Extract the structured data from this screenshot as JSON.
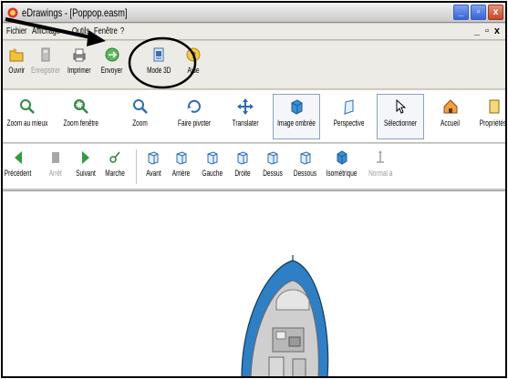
{
  "window": {
    "title": "eDrawings - [Poppop.easm]",
    "controls": {
      "minimize": "_",
      "restore": "▫",
      "close": "x"
    }
  },
  "menubar": {
    "items": [
      "Fichier",
      "Affichage",
      "Outils",
      "Fenêtre",
      "?"
    ],
    "mdi_controls": [
      "_",
      "▫",
      "x"
    ]
  },
  "toolbar_main": {
    "buttons": [
      {
        "label": "Ouvrir",
        "icon": "open-folder-icon",
        "enabled": true
      },
      {
        "label": "Enregistrer",
        "icon": "save-icon",
        "enabled": false
      },
      {
        "label": "Imprimer",
        "icon": "printer-icon",
        "enabled": true
      },
      {
        "label": "Envoyer",
        "icon": "send-icon",
        "enabled": true
      },
      {
        "label": "Mode 3D",
        "icon": "mode-3d-icon",
        "enabled": true
      },
      {
        "label": "Aide",
        "icon": "help-icon",
        "enabled": true
      }
    ]
  },
  "toolbar_view": {
    "buttons": [
      {
        "label": "Zoom au mieux",
        "icon": "zoom-fit-icon"
      },
      {
        "label": "Zoom fenêtre",
        "icon": "zoom-window-icon"
      },
      {
        "label": "Zoom",
        "icon": "zoom-icon"
      },
      {
        "label": "Faire pivoter",
        "icon": "rotate-icon"
      },
      {
        "label": "Translater",
        "icon": "pan-icon"
      },
      {
        "label": "Image ombrée",
        "icon": "shaded-icon"
      },
      {
        "label": "Perspective",
        "icon": "perspective-icon"
      },
      {
        "label": "Sélectionner",
        "icon": "select-cursor-icon"
      },
      {
        "label": "Accueil",
        "icon": "home-icon"
      },
      {
        "label": "Propriétés",
        "icon": "properties-icon"
      }
    ]
  },
  "toolbar_nav": {
    "buttons": [
      {
        "label": "Précédent",
        "icon": "previous-icon",
        "enabled": true
      },
      {
        "label": "Arrêt",
        "icon": "stop-icon",
        "enabled": false
      },
      {
        "label": "Suivant",
        "icon": "next-icon",
        "enabled": true
      },
      {
        "label": "Marche",
        "icon": "play-icon",
        "enabled": true
      },
      {
        "label": "Avant",
        "icon": "view-front-icon",
        "enabled": true
      },
      {
        "label": "Arrière",
        "icon": "view-back-icon",
        "enabled": true
      },
      {
        "label": "Gauche",
        "icon": "view-left-icon",
        "enabled": true
      },
      {
        "label": "Droite",
        "icon": "view-right-icon",
        "enabled": true
      },
      {
        "label": "Dessus",
        "icon": "view-top-icon",
        "enabled": true
      },
      {
        "label": "Dessous",
        "icon": "view-bottom-icon",
        "enabled": true
      },
      {
        "label": "Isométrique",
        "icon": "view-iso-icon",
        "enabled": true
      },
      {
        "label": "Normal à",
        "icon": "normal-to-icon",
        "enabled": false
      }
    ]
  },
  "colors": {
    "accent_blue": "#2f7fc4",
    "toolbar_bg": "#ecebe6",
    "annotation": "#000000"
  }
}
